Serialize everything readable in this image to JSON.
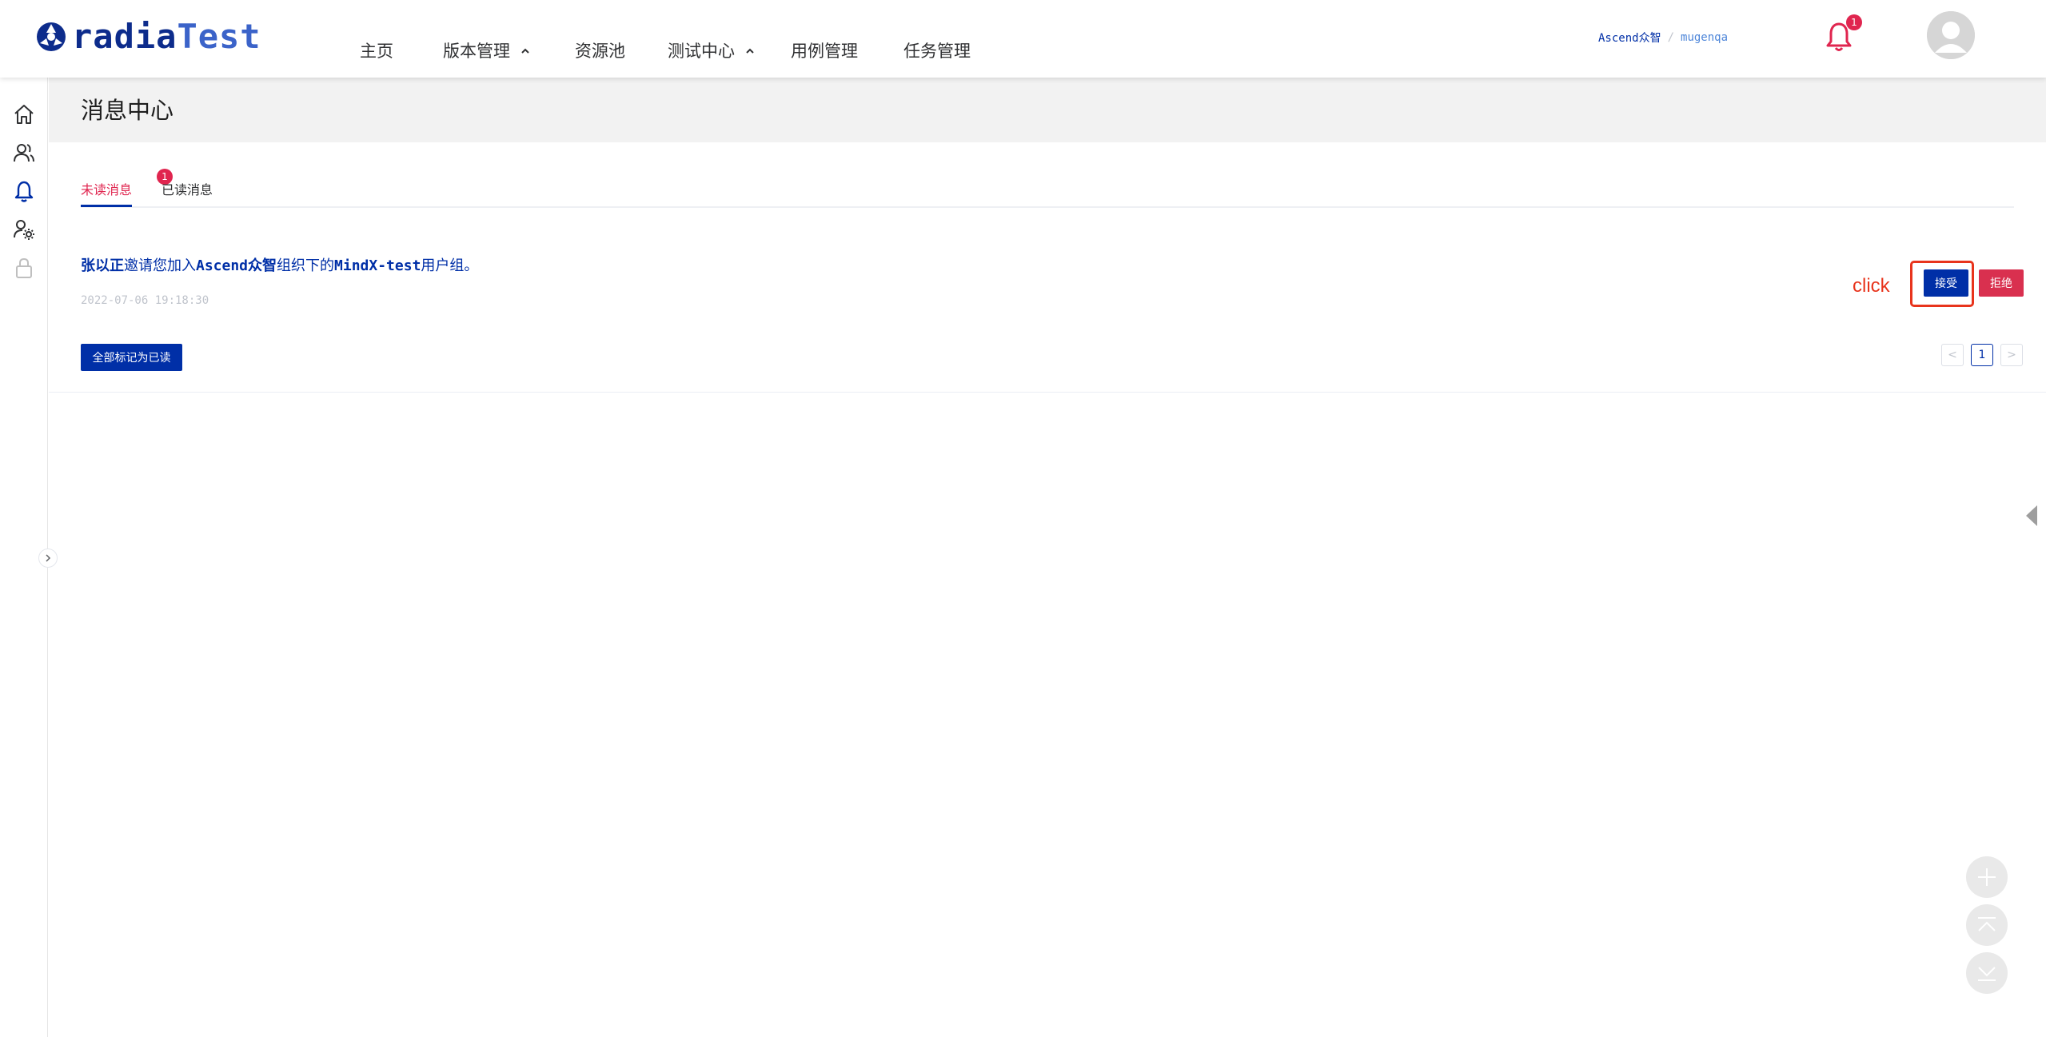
{
  "brand": {
    "logo_part1": "radia",
    "logo_part2": "Test"
  },
  "nav": [
    {
      "label": "主页"
    },
    {
      "label": "版本管理",
      "has_caret": true
    },
    {
      "label": "资源池"
    },
    {
      "label": "测试中心",
      "has_caret": true
    },
    {
      "label": "用例管理"
    },
    {
      "label": "任务管理"
    }
  ],
  "header": {
    "org": "Ascend众智",
    "user": "mugenqa",
    "notification_count": "1"
  },
  "sidebar": {
    "icons": [
      "home-icon",
      "users-icon",
      "bell-icon",
      "user-settings-icon",
      "lock-icon"
    ]
  },
  "page": {
    "title": "消息中心"
  },
  "tabs": {
    "unread": "未读消息",
    "unread_count": "1",
    "read": "已读消息"
  },
  "message": {
    "sender": "张以正",
    "t1": "邀请您加入",
    "org": "Ascend众智",
    "t2": "组织下的",
    "group": "MindX-test",
    "t3": "用户组。",
    "time": "2022-07-06 19:18:30"
  },
  "annotation": {
    "label": "click",
    "color": "#e8341c"
  },
  "actions": {
    "accept": "接受",
    "reject": "拒绝",
    "mark_all_read": "全部标记为已读"
  },
  "pagination": {
    "prev": "<",
    "current": "1",
    "next": ">"
  },
  "colors": {
    "primary": "#002fa7",
    "danger": "#e0254f",
    "reject": "#d9304f"
  }
}
